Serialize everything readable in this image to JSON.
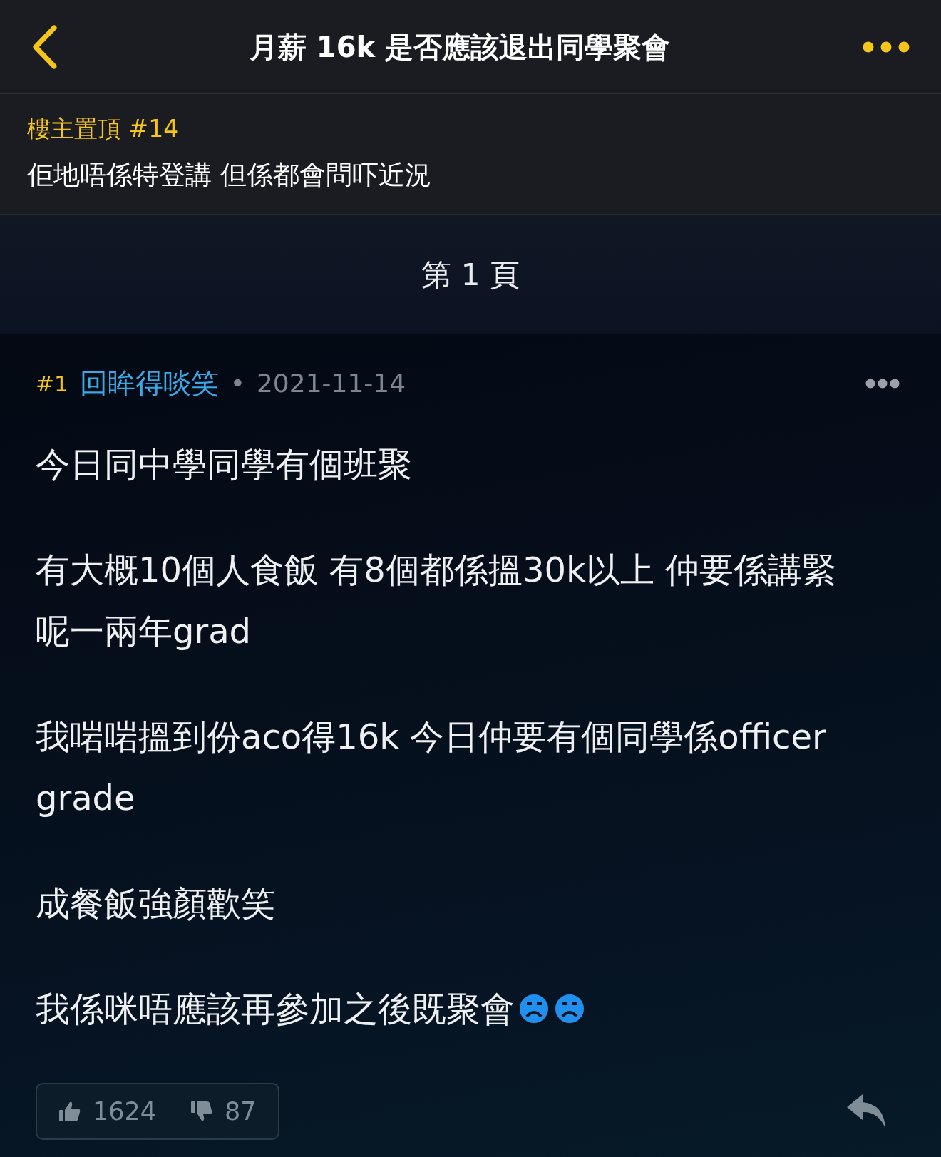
{
  "header": {
    "title": "月薪 16k 是否應該退出同學聚會"
  },
  "pinned": {
    "label": "樓主置頂 #14",
    "text": "佢地唔係特登講 但係都會問吓近況"
  },
  "page_label": "第 1 頁",
  "post": {
    "floor": "#1",
    "author": "回眸得啖笑",
    "separator": "•",
    "date": "2021-11-14",
    "paragraphs": [
      {
        "text": "今日同中學同學有個班聚"
      },
      {
        "text": "有大概10個人食飯 有8個都係搵30k以上 仲要係講緊呢一兩年grad"
      },
      {
        "text": "我啱啱搵到份aco得16k 今日仲要有個同學係officer grade"
      },
      {
        "text": "成餐飯強顏歡笑"
      },
      {
        "text": "我係咪唔應該再參加之後既聚會",
        "emojis": [
          {
            "kind": "sad"
          },
          {
            "kind": "sad"
          }
        ]
      }
    ],
    "likes": "1624",
    "dislikes": "87"
  }
}
